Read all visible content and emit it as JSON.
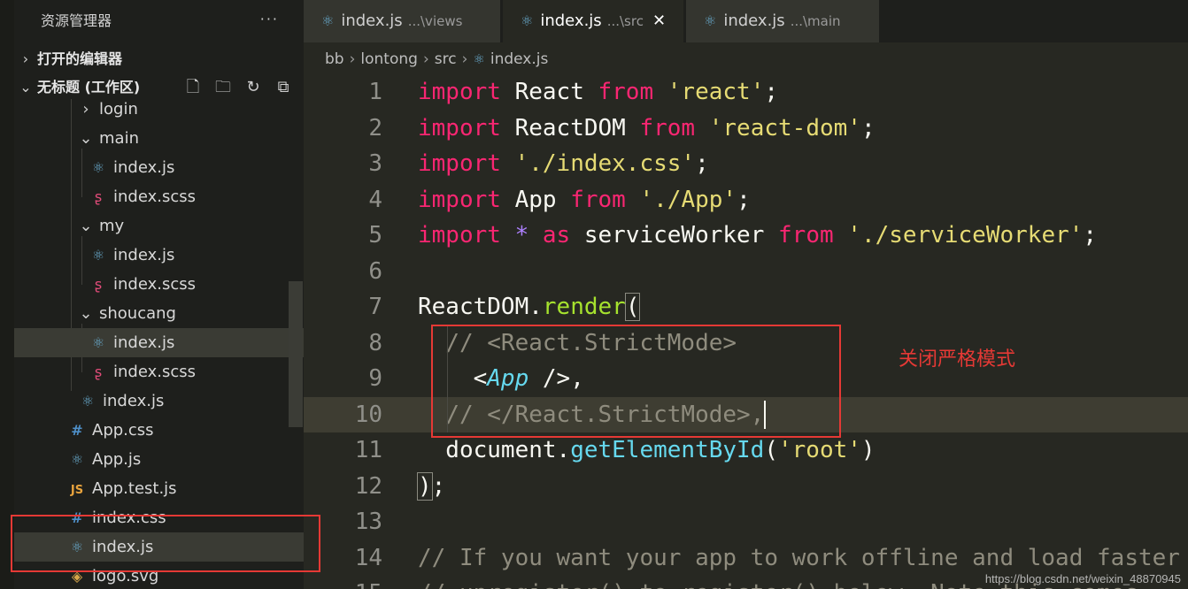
{
  "explorer": {
    "title": "资源管理器",
    "more_label": "···",
    "open_editors": "打开的编辑器",
    "workspace": "无标题 (工作区)",
    "tree": [
      {
        "label": "login",
        "type": "folder",
        "chev": "›",
        "icon": "chevron-right"
      },
      {
        "label": "main",
        "type": "folder",
        "chev": "⌄",
        "icon": "chevron-down"
      },
      {
        "label": "index.js",
        "type": "react"
      },
      {
        "label": "index.scss",
        "type": "sass"
      },
      {
        "label": "my",
        "type": "folder",
        "chev": "⌄"
      },
      {
        "label": "index.js",
        "type": "react"
      },
      {
        "label": "index.scss",
        "type": "sass"
      },
      {
        "label": "shoucang",
        "type": "folder",
        "chev": "⌄"
      },
      {
        "label": "index.js",
        "type": "react",
        "selected": true
      },
      {
        "label": "index.scss",
        "type": "sass"
      },
      {
        "label": "index.js",
        "type": "react"
      },
      {
        "label": "App.css",
        "type": "css"
      },
      {
        "label": "App.js",
        "type": "react"
      },
      {
        "label": "App.test.js",
        "type": "js"
      },
      {
        "label": "index.css",
        "type": "css"
      },
      {
        "label": "index.js",
        "type": "react",
        "selected": true
      },
      {
        "label": "logo.svg",
        "type": "svg"
      }
    ]
  },
  "tabs": [
    {
      "name": "index.js",
      "desc": "...\\views",
      "active": false
    },
    {
      "name": "index.js",
      "desc": "...\\src",
      "active": true,
      "close": "✕"
    },
    {
      "name": "index.js",
      "desc": "...\\main",
      "active": false
    }
  ],
  "breadcrumb": [
    "bb",
    "lontong",
    "src",
    "index.js"
  ],
  "editor": {
    "line_numbers": [
      "1",
      "2",
      "3",
      "4",
      "5",
      "6",
      "7",
      "8",
      "9",
      "10",
      "11",
      "12",
      "13",
      "14",
      "15"
    ],
    "current_line": 10
  },
  "annotation": "关闭严格模式",
  "watermark": "https://blog.csdn.net/weixin_48870945",
  "colors": {
    "accent_red": "#e53935",
    "keyword": "#f92672",
    "string": "#e6db74"
  }
}
